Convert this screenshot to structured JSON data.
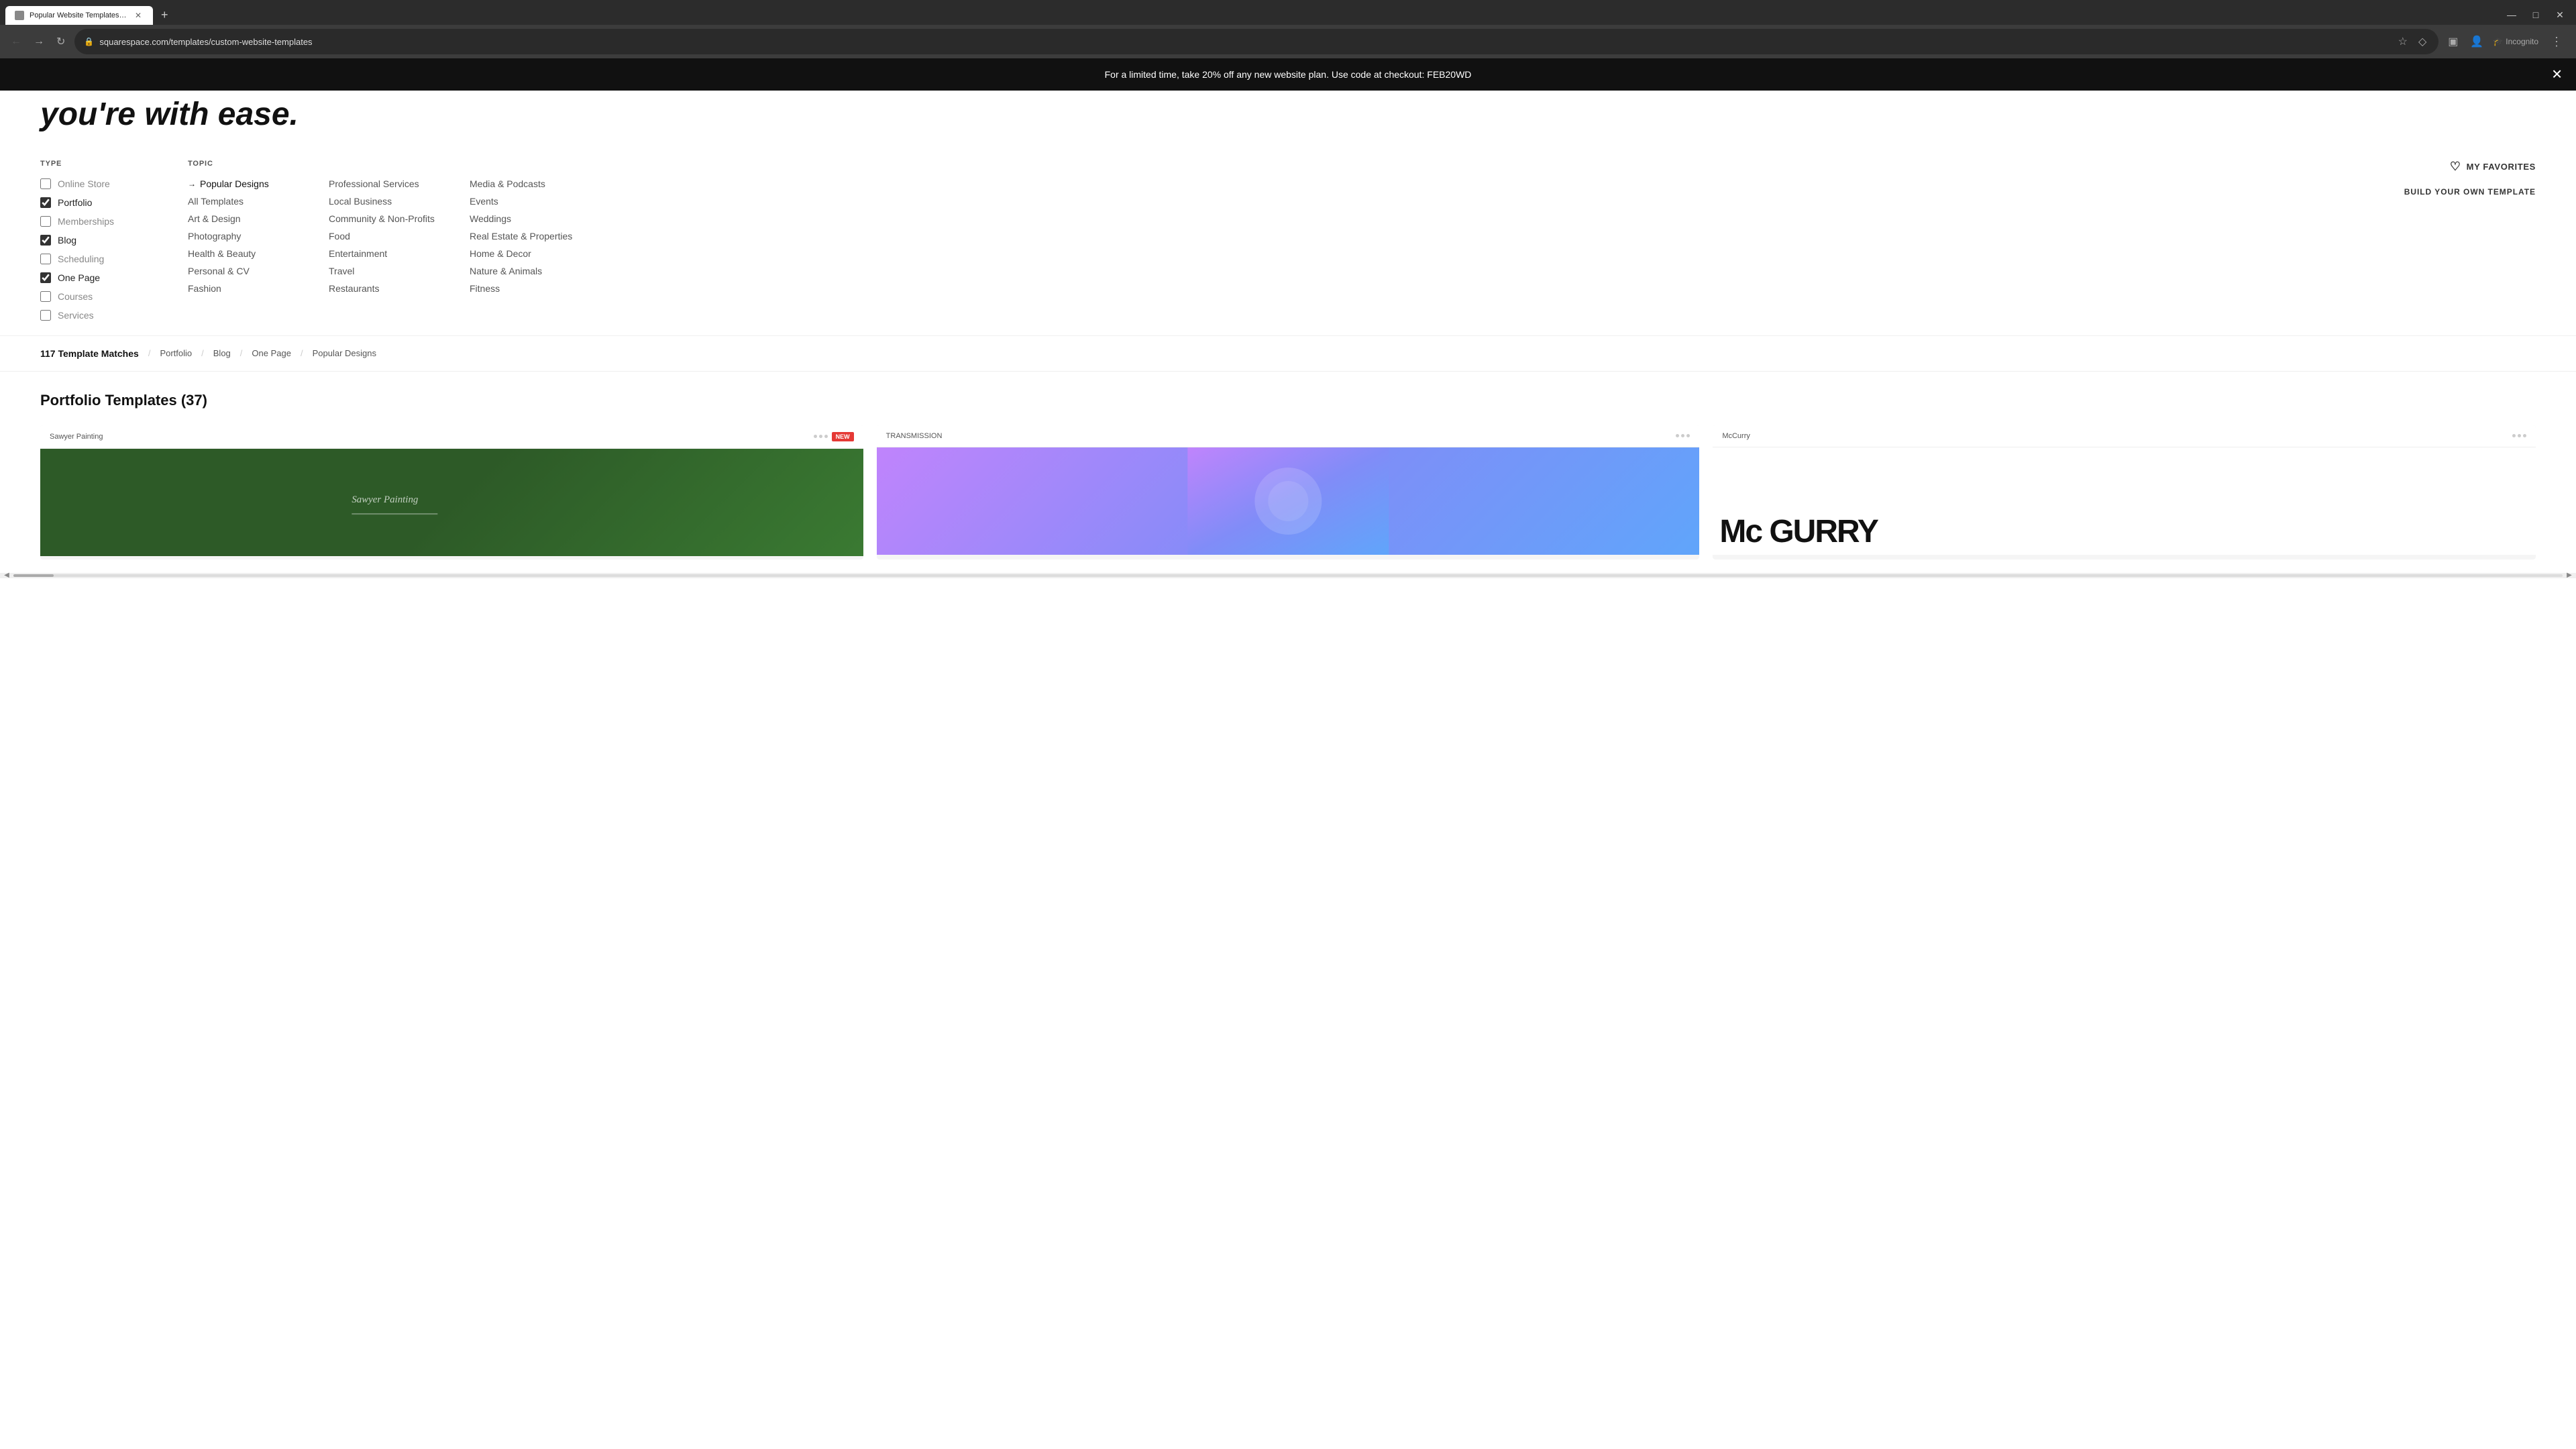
{
  "browser": {
    "tab_title": "Popular Website Templates - Po",
    "url": "squarespace.com/templates/custom-website-templates",
    "incognito_label": "Incognito"
  },
  "banner": {
    "text": "For a limited time, take 20% off any new website plan. Use code at checkout: FEB20WD"
  },
  "hero": {
    "partial_text": "you're with ease."
  },
  "filter": {
    "type_label": "TYPE",
    "topic_label": "TOPIC",
    "type_options": [
      {
        "label": "Online Store",
        "checked": false
      },
      {
        "label": "Portfolio",
        "checked": true
      },
      {
        "label": "Memberships",
        "checked": false
      },
      {
        "label": "Blog",
        "checked": true
      },
      {
        "label": "Scheduling",
        "checked": false
      },
      {
        "label": "One Page",
        "checked": true
      },
      {
        "label": "Courses",
        "checked": false
      },
      {
        "label": "Services",
        "checked": false
      }
    ],
    "topic_col1": [
      {
        "label": "Popular Designs",
        "active": true,
        "arrow": true
      },
      {
        "label": "All Templates",
        "active": false,
        "arrow": false
      },
      {
        "label": "Art & Design",
        "active": false,
        "arrow": false
      },
      {
        "label": "Photography",
        "active": false,
        "arrow": false
      },
      {
        "label": "Health & Beauty",
        "active": false,
        "arrow": false
      },
      {
        "label": "Personal & CV",
        "active": false,
        "arrow": false
      },
      {
        "label": "Fashion",
        "active": false,
        "arrow": false
      }
    ],
    "topic_col2": [
      {
        "label": "Professional Services",
        "active": false
      },
      {
        "label": "Local Business",
        "active": false
      },
      {
        "label": "Community & Non-Profits",
        "active": false
      },
      {
        "label": "Food",
        "active": false
      },
      {
        "label": "Entertainment",
        "active": false
      },
      {
        "label": "Travel",
        "active": false
      },
      {
        "label": "Restaurants",
        "active": false
      }
    ],
    "topic_col3": [
      {
        "label": "Media & Podcasts",
        "active": false
      },
      {
        "label": "Events",
        "active": false
      },
      {
        "label": "Weddings",
        "active": false
      },
      {
        "label": "Real Estate & Properties",
        "active": false
      },
      {
        "label": "Home & Decor",
        "active": false
      },
      {
        "label": "Nature & Animals",
        "active": false
      },
      {
        "label": "Fitness",
        "active": false
      }
    ],
    "favorites_label": "MY FAVORITES",
    "build_own_label": "BUILD YOUR OWN TEMPLATE"
  },
  "results": {
    "count_label": "117 Template Matches",
    "tags": [
      "Portfolio",
      "Blog",
      "One Page",
      "Popular Designs"
    ]
  },
  "templates_section": {
    "title": "Portfolio Templates (37)",
    "cards": [
      {
        "name": "Sawyer Painting",
        "badge": "NEW",
        "preview_type": "green",
        "preview_text": ""
      },
      {
        "name": "TRANSMISSION",
        "badge": "",
        "preview_type": "purple",
        "preview_text": ""
      },
      {
        "name": "McCurry",
        "badge": "",
        "preview_type": "white",
        "preview_text": "Mc GURRY"
      }
    ]
  }
}
